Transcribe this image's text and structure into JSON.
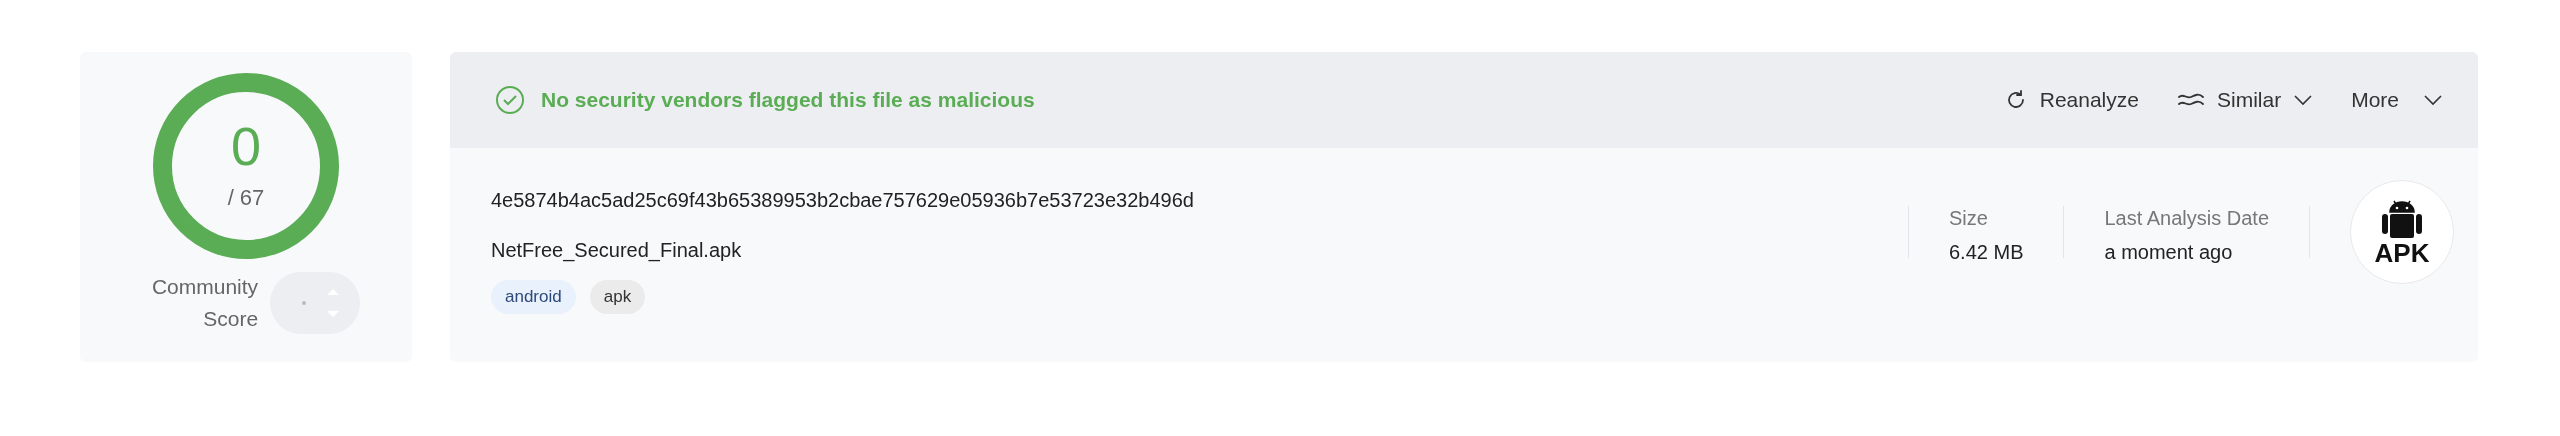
{
  "score": {
    "detections": "0",
    "total": "/ 67",
    "label_lines": [
      "Community",
      "Score"
    ]
  },
  "banner": {
    "clean": true,
    "message": "No security vendors flagged this file as malicious"
  },
  "actions": [
    {
      "kind": "reanalyze",
      "label": "Reanalyze"
    },
    {
      "kind": "similar",
      "label": "Similar"
    },
    {
      "kind": "more",
      "label": "More"
    }
  ],
  "file": {
    "hash": "4e5874b4ac5ad25c69f43b65389953b2cbae757629e05936b7e53723e32b496d",
    "name": "NetFree_Secured_Final.apk",
    "tags": [
      {
        "label": "android",
        "kind": "platform"
      },
      {
        "label": "apk",
        "kind": "type"
      }
    ]
  },
  "stats": [
    {
      "label": "Size",
      "value": "6.42 MB"
    },
    {
      "label": "Last Analysis Date",
      "value": "a moment ago"
    }
  ],
  "file_type": {
    "label": "APK"
  }
}
